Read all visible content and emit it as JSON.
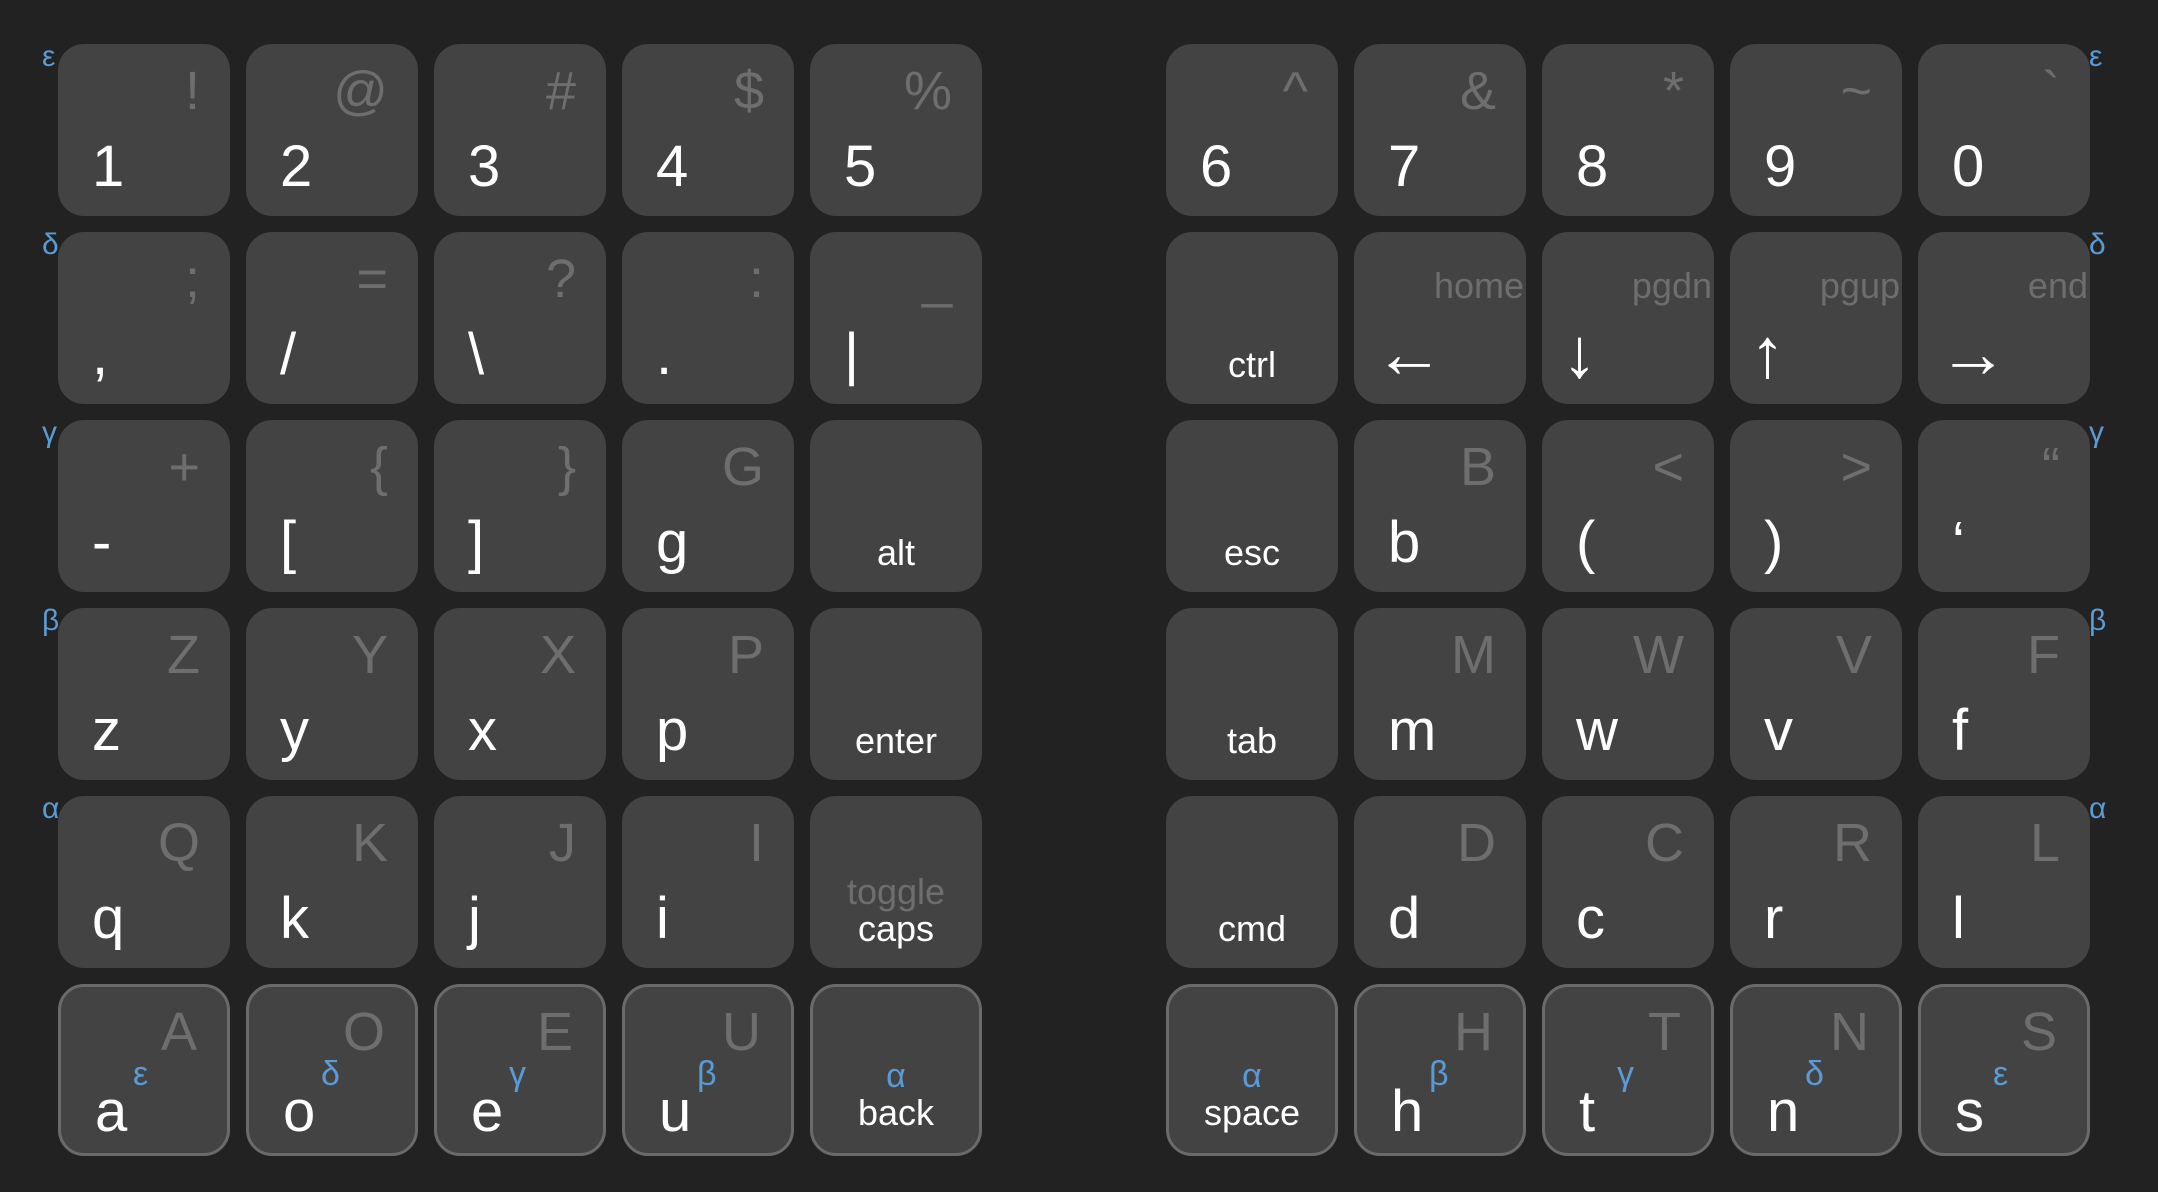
{
  "accent_color": "#5b9bd5",
  "row_labels": {
    "left": [
      "ε",
      "δ",
      "γ",
      "β",
      "α"
    ],
    "right": [
      "ε",
      "δ",
      "γ",
      "β",
      "α"
    ]
  },
  "left_half": {
    "row1": [
      {
        "primary": "1",
        "secondary": "!"
      },
      {
        "primary": "2",
        "secondary": "@"
      },
      {
        "primary": "3",
        "secondary": "#"
      },
      {
        "primary": "4",
        "secondary": "$"
      },
      {
        "primary": "5",
        "secondary": "%"
      }
    ],
    "row2": [
      {
        "primary": ",",
        "secondary": ";"
      },
      {
        "primary": "/",
        "secondary": "="
      },
      {
        "primary": "\\",
        "secondary": "?"
      },
      {
        "primary": ".",
        "secondary": ":"
      },
      {
        "primary": "|",
        "secondary": "_"
      }
    ],
    "row3": [
      {
        "primary": "-",
        "secondary": "+"
      },
      {
        "primary": "[",
        "secondary": "{"
      },
      {
        "primary": "]",
        "secondary": "}"
      },
      {
        "primary": "g",
        "secondary": "G"
      },
      {
        "primary": "alt",
        "secondary": ""
      }
    ],
    "row4": [
      {
        "primary": "z",
        "secondary": "Z"
      },
      {
        "primary": "y",
        "secondary": "Y"
      },
      {
        "primary": "x",
        "secondary": "X"
      },
      {
        "primary": "p",
        "secondary": "P"
      },
      {
        "primary": "enter",
        "secondary": ""
      }
    ],
    "row5": [
      {
        "primary": "q",
        "secondary": "Q"
      },
      {
        "primary": "k",
        "secondary": "K"
      },
      {
        "primary": "j",
        "secondary": "J"
      },
      {
        "primary": "i",
        "secondary": "I"
      },
      {
        "primary": "caps",
        "secondary": "toggle"
      }
    ],
    "thumb": [
      {
        "primary": "a",
        "secondary": "A",
        "layer": "ε"
      },
      {
        "primary": "o",
        "secondary": "O",
        "layer": "δ"
      },
      {
        "primary": "e",
        "secondary": "E",
        "layer": "γ"
      },
      {
        "primary": "u",
        "secondary": "U",
        "layer": "β"
      },
      {
        "primary": "back",
        "secondary": "",
        "layer": "α"
      }
    ]
  },
  "right_half": {
    "row1": [
      {
        "primary": "6",
        "secondary": "^"
      },
      {
        "primary": "7",
        "secondary": "&"
      },
      {
        "primary": "8",
        "secondary": "*"
      },
      {
        "primary": "9",
        "secondary": "~"
      },
      {
        "primary": "0",
        "secondary": "`"
      }
    ],
    "row2": [
      {
        "primary": "ctrl",
        "secondary": ""
      },
      {
        "primary": "←",
        "secondary": "home"
      },
      {
        "primary": "↓",
        "secondary": "pgdn"
      },
      {
        "primary": "↑",
        "secondary": "pgup"
      },
      {
        "primary": "→",
        "secondary": "end"
      }
    ],
    "row3": [
      {
        "primary": "esc",
        "secondary": ""
      },
      {
        "primary": "b",
        "secondary": "B"
      },
      {
        "primary": "(",
        "secondary": "<"
      },
      {
        "primary": ")",
        "secondary": ">"
      },
      {
        "primary": "‘",
        "secondary": "“"
      }
    ],
    "row4": [
      {
        "primary": "tab",
        "secondary": ""
      },
      {
        "primary": "m",
        "secondary": "M"
      },
      {
        "primary": "w",
        "secondary": "W"
      },
      {
        "primary": "v",
        "secondary": "V"
      },
      {
        "primary": "f",
        "secondary": "F"
      }
    ],
    "row5": [
      {
        "primary": "cmd",
        "secondary": ""
      },
      {
        "primary": "d",
        "secondary": "D"
      },
      {
        "primary": "c",
        "secondary": "C"
      },
      {
        "primary": "r",
        "secondary": "R"
      },
      {
        "primary": "l",
        "secondary": "L"
      }
    ],
    "thumb": [
      {
        "primary": "space",
        "secondary": "",
        "layer": "α"
      },
      {
        "primary": "h",
        "secondary": "H",
        "layer": "β"
      },
      {
        "primary": "t",
        "secondary": "T",
        "layer": "γ"
      },
      {
        "primary": "n",
        "secondary": "N",
        "layer": "δ"
      },
      {
        "primary": "s",
        "secondary": "S",
        "layer": "ε"
      }
    ]
  }
}
